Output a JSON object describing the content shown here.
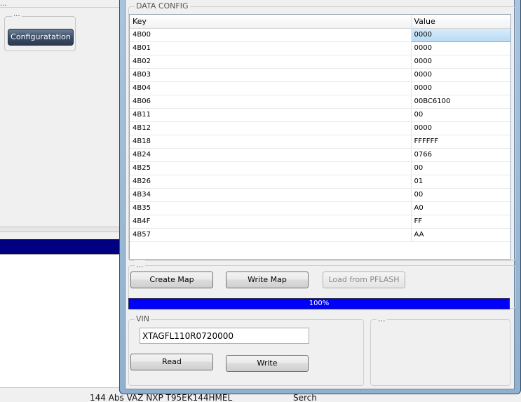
{
  "background": {
    "top_dots": "...",
    "group_dots": "...",
    "config_button": "Configuratation",
    "status_text_1": "144 Abs VAZ NXP T95EK144HMEL",
    "status_text_2": "Serch"
  },
  "dialog": {
    "data_config": {
      "legend": "DATA CONFIG",
      "columns": [
        "Key",
        "Value"
      ],
      "rows": [
        {
          "key": "4B00",
          "value": "0000"
        },
        {
          "key": "4B01",
          "value": "0000"
        },
        {
          "key": "4B02",
          "value": "0000"
        },
        {
          "key": "4B03",
          "value": "0000"
        },
        {
          "key": "4B04",
          "value": "0000"
        },
        {
          "key": "4B06",
          "value": "00BC6100"
        },
        {
          "key": "4B11",
          "value": "00"
        },
        {
          "key": "4B12",
          "value": "0000"
        },
        {
          "key": "4B18",
          "value": "FFFFFF"
        },
        {
          "key": "4B24",
          "value": "0766"
        },
        {
          "key": "4B25",
          "value": "00"
        },
        {
          "key": "4B26",
          "value": "01"
        },
        {
          "key": "4B34",
          "value": "00"
        },
        {
          "key": "4B35",
          "value": "A0"
        },
        {
          "key": "4B4F",
          "value": "FF"
        },
        {
          "key": "4B57",
          "value": "AA"
        }
      ]
    },
    "map_group": {
      "legend": "...",
      "create_map": "Create Map",
      "write_map": "Write Map",
      "load_pflash": "Load from PFLASH"
    },
    "progress": {
      "label": "100%",
      "value": 1.0,
      "color": "#0000ff"
    },
    "vin_group": {
      "legend": "VIN",
      "value": "XTAGFL110R0720000",
      "read": "Read",
      "write": "Write"
    },
    "extra_group": {
      "legend": "..."
    }
  }
}
